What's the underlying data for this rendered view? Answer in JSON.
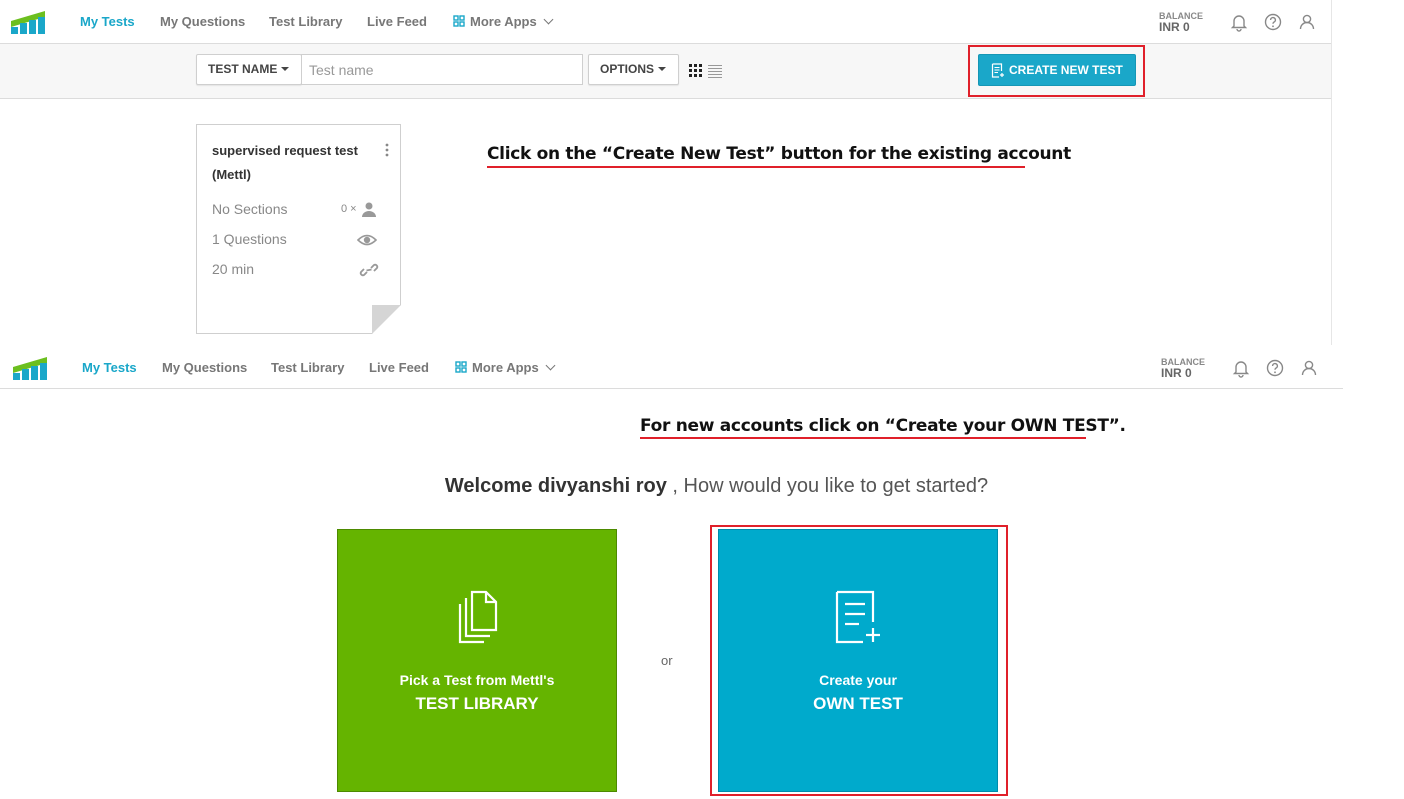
{
  "nav": {
    "items": [
      {
        "label": "My Tests",
        "active": true
      },
      {
        "label": "My Questions",
        "active": false
      },
      {
        "label": "Test Library",
        "active": false
      },
      {
        "label": "Live Feed",
        "active": false
      },
      {
        "label": "More Apps",
        "active": false
      }
    ],
    "balance_label": "BALANCE",
    "balance_value": "INR 0"
  },
  "toolbar": {
    "filter_label": "TEST NAME",
    "search_placeholder": "Test name",
    "options_label": "OPTIONS",
    "create_label": "CREATE NEW TEST"
  },
  "test_card": {
    "title": "supervised request test (Mettl)",
    "sections": "No Sections",
    "candidates": "0 ×",
    "questions": "1 Questions",
    "duration": "20 min"
  },
  "annotations": {
    "existing": "Click on the “Create New Test” button for the existing account",
    "new_account": "For new accounts click on “Create your OWN TEST”."
  },
  "welcome": {
    "name": "Welcome divyanshi roy",
    "question": " , How would you like to get started?"
  },
  "tiles": {
    "library_line1": "Pick a Test from Mettl's",
    "library_line2": "TEST LIBRARY",
    "or": "or",
    "own_line1": "Create your",
    "own_line2": "OWN TEST"
  },
  "colors": {
    "accent": "#1aa7c9",
    "green_tile": "#65b400",
    "blue_tile": "#00aacc",
    "highlight": "#e0202a"
  }
}
